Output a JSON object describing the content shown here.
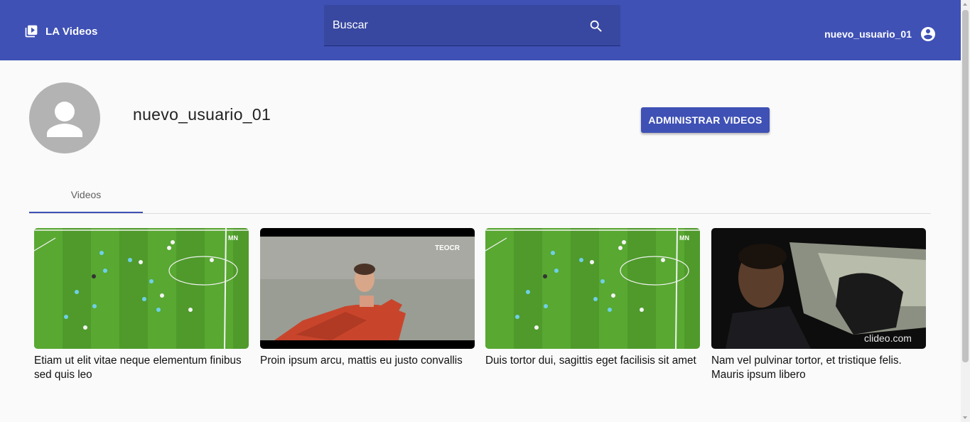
{
  "header": {
    "brand_title": "LA Videos",
    "brand_icon": "video-library-icon",
    "search_placeholder": "Buscar",
    "search_icon": "search-icon",
    "username": "nuevo_usuario_01",
    "user_icon": "account-circle-icon"
  },
  "profile": {
    "avatar_icon": "person-icon",
    "name": "nuevo_usuario_01",
    "manage_button": "ADMINISTRAR VIDEOS"
  },
  "tabs": [
    {
      "label": "Videos",
      "active": true
    }
  ],
  "videos": [
    {
      "title": "Etiam ut elit vitae neque elementum finibus sed quis leo",
      "thumbnail": "football-pitch",
      "watermark": "MN"
    },
    {
      "title": "Proin ipsum arcu, mattis eu justo convallis",
      "thumbnail": "player-celebration",
      "watermark": "TEOCR"
    },
    {
      "title": "Duis tortor dui, sagittis eget facilisis sit amet",
      "thumbnail": "football-pitch",
      "watermark": "MN"
    },
    {
      "title": "Nam vel pulvinar tortor, et tristique felis. Mauris ipsum libero",
      "thumbnail": "man-driving-car",
      "watermark": "clideo.com"
    }
  ],
  "colors": {
    "primary": "#3f51b5",
    "search_bg": "#3848a0",
    "background": "#fafafa",
    "avatar_bg": "#b3b3b3"
  }
}
